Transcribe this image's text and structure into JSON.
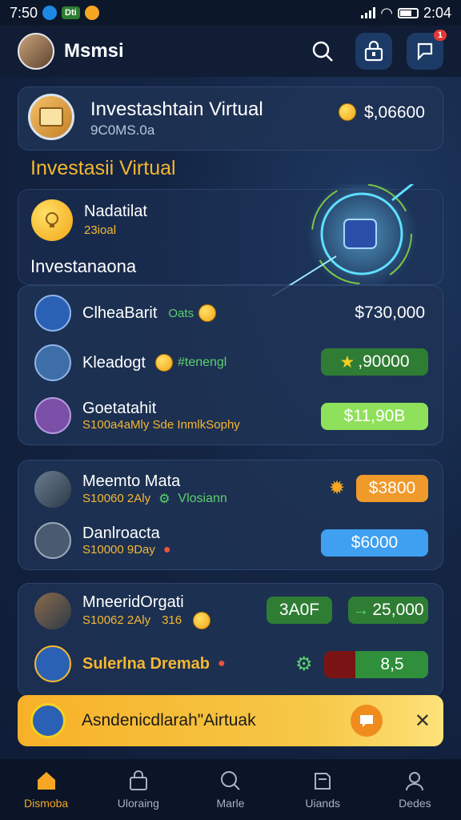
{
  "status": {
    "time_left": "7:50",
    "time_right": "2:04",
    "pill_label": "Dti"
  },
  "header": {
    "app_name": "Msmsi",
    "notif_badge": "1"
  },
  "portfolio": {
    "title": "Investashtain Virtual",
    "subtitle": "9C0MS.0a",
    "balance": "$,06600"
  },
  "section_yellow": "Investasii Virtual",
  "highlight": {
    "name": "Nadatilat",
    "meta": "23ioal"
  },
  "section_invest": "Investanaona",
  "group1": [
    {
      "name": "ClheaBarit",
      "meta": "Oats",
      "value": "$730,000",
      "pill": "",
      "pill_color": "none",
      "icon_color": "#2a61b5"
    },
    {
      "name": "Kleadogt",
      "meta": "#tenengl",
      "value": "",
      "pill": ",90000",
      "pill_color": "#2f7d34",
      "icon_color": "#3d6ea8"
    },
    {
      "name": "Goetatahit",
      "meta": "S100a4aMly   Sde InmlkSophy",
      "value": "",
      "pill": "$11,90B",
      "pill_color": "#8fe05a",
      "icon_color": "#7b4ea8"
    }
  ],
  "group2": [
    {
      "name": "Meemto Mata",
      "meta": "S10060 2Aly",
      "meta2": "Vlosiann",
      "pill": "$3800",
      "pill_color": "#f09a2b"
    },
    {
      "name": "Danlroacta",
      "meta": "S10000 9Day",
      "meta2": "",
      "pill": "$6000",
      "pill_color": "#3f9ff0"
    }
  ],
  "group3": [
    {
      "name": "MneeridOrgati",
      "meta": "S10062 2Aly",
      "meta2": "316",
      "pill_a": "3A0F",
      "pill_b": "25,000",
      "pill_color": "#2f7d34"
    },
    {
      "name": "Sulerlna Dremab",
      "meta": "",
      "meta2": "",
      "pill_a": "",
      "pill_b": "8,5",
      "pill_color": "#2f8f3a"
    }
  ],
  "banner": {
    "text": "Asndenicdlarah\"Airtuak"
  },
  "nav": [
    {
      "label": "Dismoba",
      "icon": "home-icon"
    },
    {
      "label": "Uloraing",
      "icon": "bag-icon"
    },
    {
      "label": "Marle",
      "icon": "search-icon"
    },
    {
      "label": "Uiands",
      "icon": "book-icon"
    },
    {
      "label": "Dedes",
      "icon": "user-icon"
    }
  ],
  "colors": {
    "accent": "#f5a623",
    "bg": "#142544",
    "card": "#1e3255"
  }
}
